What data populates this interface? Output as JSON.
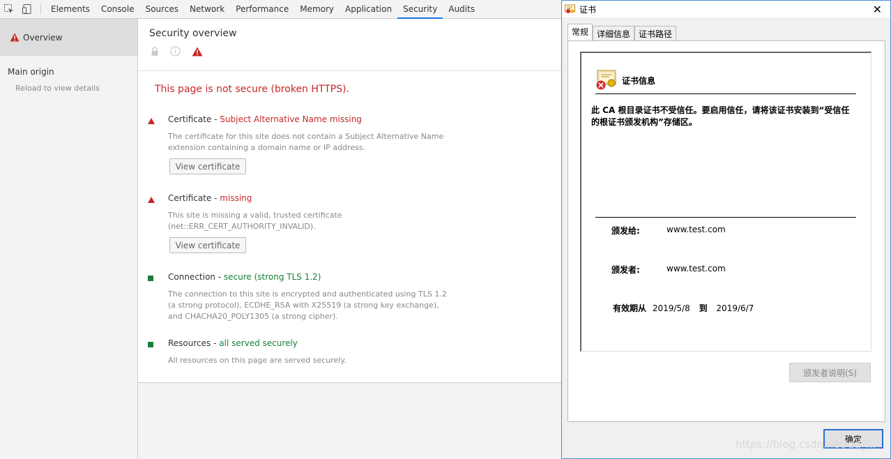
{
  "toolbar": {
    "tabs": [
      "Elements",
      "Console",
      "Sources",
      "Network",
      "Performance",
      "Memory",
      "Application",
      "Security",
      "Audits"
    ],
    "active_tab": "Security"
  },
  "sidebar": {
    "overview_label": "Overview",
    "main_origin_label": "Main origin",
    "reload_label": "Reload to view details"
  },
  "main": {
    "title": "Security overview",
    "headline": "This page is not secure (broken HTTPS).",
    "items": [
      {
        "prefix": "Certificate - ",
        "status": "Subject Alternative Name missing",
        "status_color": "#c62828",
        "description": "The certificate for this site does not contain a Subject Alternative Name extension containing a domain name or IP address.",
        "button": "View certificate"
      },
      {
        "prefix": "Certificate - ",
        "status": "missing",
        "status_color": "#c62828",
        "description": "This site is missing a valid, trusted certificate (net::ERR_CERT_AUTHORITY_INVALID).",
        "button": "View certificate"
      },
      {
        "prefix": "Connection - ",
        "status": "secure (strong TLS 1.2)",
        "status_color": "#188038",
        "description": "The connection to this site is encrypted and authenticated using TLS 1.2 (a strong protocol), ECDHE_RSA with X25519 (a strong key exchange), and CHACHA20_POLY1305 (a strong cipher)."
      },
      {
        "prefix": "Resources - ",
        "status": "all served securely",
        "status_color": "#188038",
        "description": "All resources on this page are served securely."
      }
    ]
  },
  "dialog": {
    "title": "证书",
    "tabs": [
      "常规",
      "详细信息",
      "证书路径"
    ],
    "active_tab": "常规",
    "cert_header": "证书信息",
    "message": "此 CA 根目录证书不受信任。要启用信任，请将该证书安装到“受信任的根证书颁发机构”存储区。",
    "issued_to_label": "颁发给:",
    "issued_to_value": "www.test.com",
    "issued_by_label": "颁发者:",
    "issued_by_value": "www.test.com",
    "validity_label": "有效期从",
    "valid_from": "2019/5/8",
    "to_label": "到",
    "valid_to": "2019/6/7",
    "issuer_statement_button": "颁发者说明(S)",
    "ok_button": "确定"
  },
  "watermark": "https://blog.csdn.net/qq_..."
}
